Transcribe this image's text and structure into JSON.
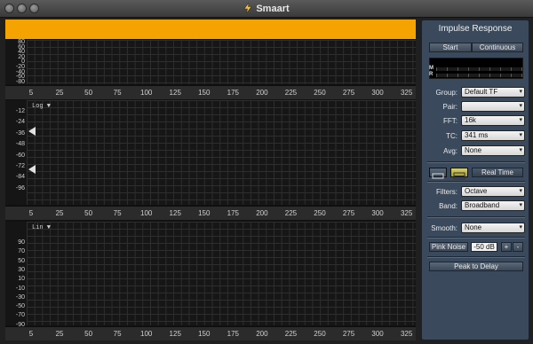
{
  "window": {
    "title": "Smaart"
  },
  "plots": {
    "top": {
      "y_ticks": [
        "80",
        "60",
        "40",
        "20",
        "0",
        "-20",
        "-40",
        "-60",
        "-80"
      ],
      "x_ticks": [
        "5",
        "25",
        "50",
        "75",
        "100",
        "125",
        "150",
        "175",
        "200",
        "225",
        "250",
        "275",
        "300",
        "325"
      ]
    },
    "middle": {
      "tag": "Log ▼",
      "y_ticks": [
        "-12",
        "-24",
        "-36",
        "-48",
        "-60",
        "-72",
        "-84",
        "-96"
      ],
      "x_ticks": [
        "5",
        "25",
        "50",
        "75",
        "100",
        "125",
        "150",
        "175",
        "200",
        "225",
        "250",
        "275",
        "300",
        "325"
      ]
    },
    "bottom": {
      "tag": "Lin ▼",
      "y_ticks": [
        "90",
        "70",
        "50",
        "30",
        "10",
        "-10",
        "-30",
        "-50",
        "-70",
        "-90"
      ],
      "x_ticks": [
        "5",
        "25",
        "50",
        "75",
        "100",
        "125",
        "150",
        "175",
        "200",
        "225",
        "250",
        "275",
        "300",
        "325"
      ]
    }
  },
  "panel": {
    "title": "Impulse Response",
    "start_label": "Start",
    "continuous_label": "Continuous",
    "meter_m": "M",
    "meter_r": "R",
    "group": {
      "label": "Group:",
      "value": "Default TF"
    },
    "pair": {
      "label": "Pair:",
      "value": ""
    },
    "fft": {
      "label": "FFT:",
      "value": "16k"
    },
    "tc": {
      "label": "TC:",
      "value": "341 ms"
    },
    "avg": {
      "label": "Avg:",
      "value": "None"
    },
    "realtime_label": "Real Time",
    "filters": {
      "label": "Filters:",
      "value": "Octave"
    },
    "band": {
      "label": "Band:",
      "value": "Broadband"
    },
    "smooth": {
      "label": "Smooth:",
      "value": "None"
    },
    "pink_noise_label": "Pink Noise",
    "pink_noise_level": "-50 dB",
    "plus_label": "+",
    "minus_label": "-",
    "peak_to_delay_label": "Peak to Delay"
  },
  "colors": {
    "accent_orange": "#f5a300",
    "panel_bg": "#3a4a5c"
  }
}
